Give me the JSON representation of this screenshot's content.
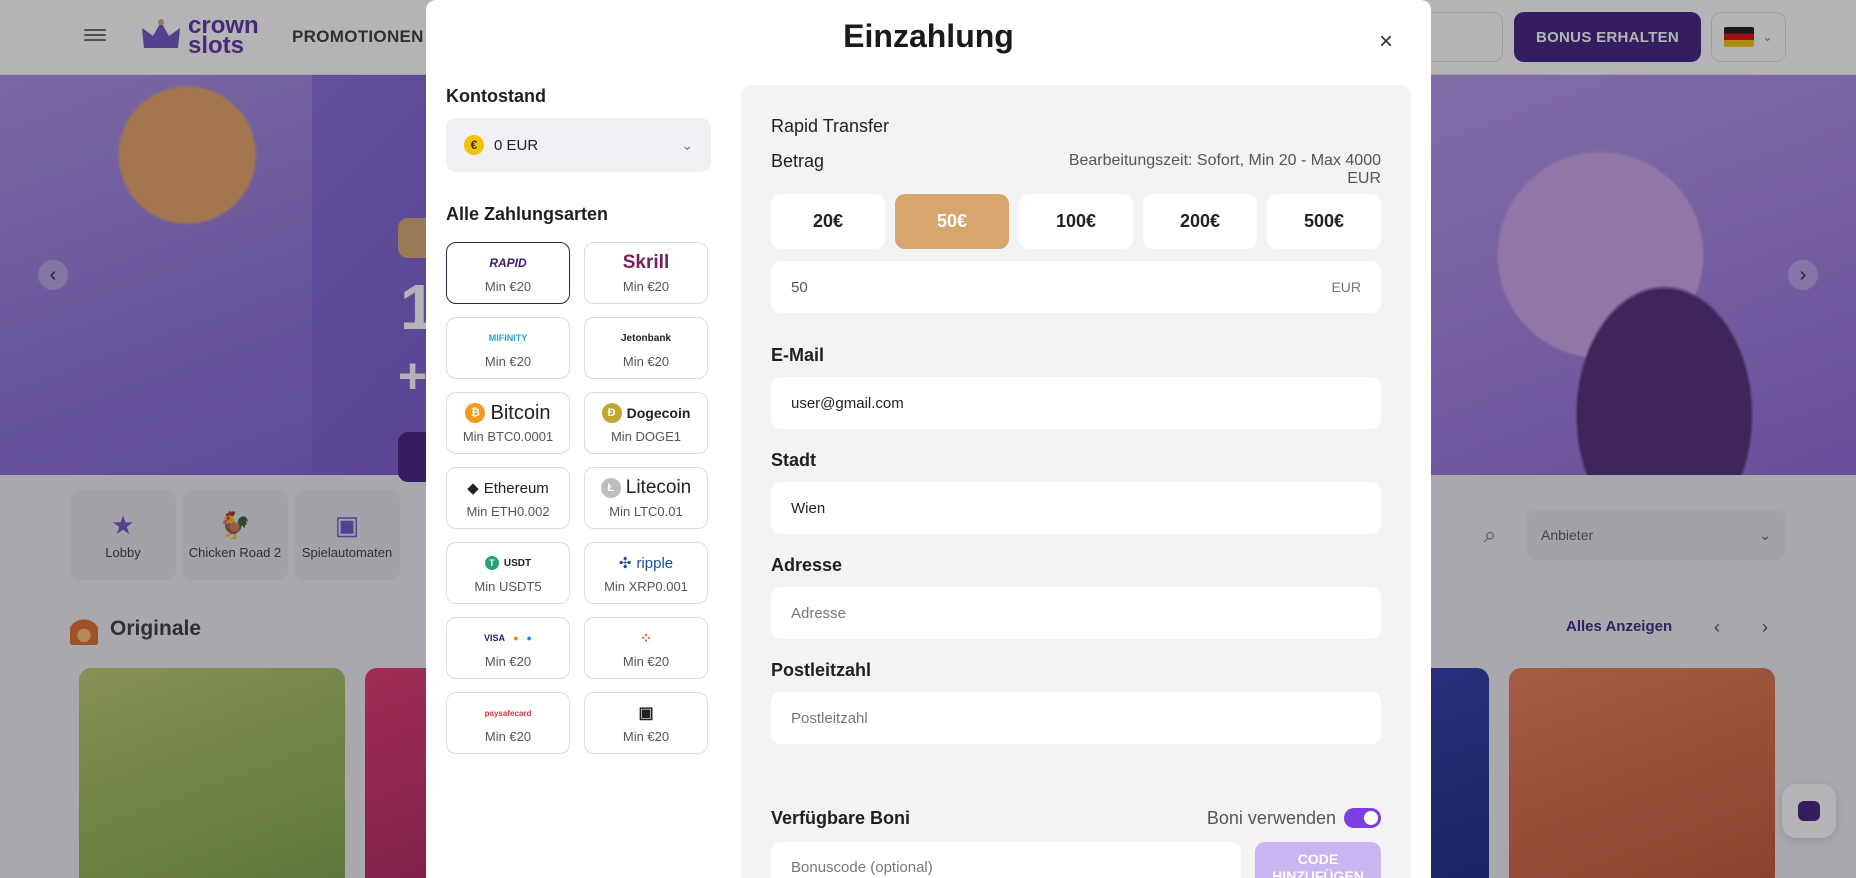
{
  "header": {
    "logo_line1": "crown",
    "logo_line2": "slots",
    "promotions": "PROMOTIONEN",
    "bonus_button": "BONUS ERHALTEN"
  },
  "banner": {
    "headline_1": "1",
    "headline_2": "+"
  },
  "categories": [
    {
      "label": "Lobby",
      "icon": "star-icon"
    },
    {
      "label": "Chicken Road 2",
      "icon": "chicken-icon"
    },
    {
      "label": "Spielautomaten",
      "icon": "slot-icon"
    }
  ],
  "filters": {
    "provider_placeholder": "Anbieter"
  },
  "originals": {
    "title": "Originale",
    "show_all": "Alles Anzeigen"
  },
  "modal": {
    "title": "Einzahlung",
    "balance_label": "Kontostand",
    "balance_value": "0 EUR",
    "currency_symbol": "€",
    "payment_methods_label": "Alle Zahlungsarten",
    "payment_methods": [
      {
        "name": "Rapid Transfer",
        "logo": "RAPID",
        "min": "Min €20",
        "selected": true
      },
      {
        "name": "Skrill",
        "logo": "Skrill",
        "min": "Min €20",
        "selected": false
      },
      {
        "name": "MiFinity",
        "logo": "MIFINITY",
        "min": "Min €20",
        "selected": false
      },
      {
        "name": "Jetonbank",
        "logo": "Jetonbank",
        "min": "Min €20",
        "selected": false
      },
      {
        "name": "Bitcoin",
        "logo": "Bitcoin",
        "min": "Min BTC0.0001",
        "selected": false
      },
      {
        "name": "Dogecoin",
        "logo": "Dogecoin",
        "min": "Min DOGE1",
        "selected": false
      },
      {
        "name": "Ethereum",
        "logo": "Ethereum",
        "min": "Min ETH0.002",
        "selected": false
      },
      {
        "name": "Litecoin",
        "logo": "Litecoin",
        "min": "Min LTC0.01",
        "selected": false
      },
      {
        "name": "USDT",
        "logo": "USDT",
        "min": "Min USDT5",
        "selected": false
      },
      {
        "name": "Ripple",
        "logo": "ripple",
        "min": "Min XRP0.001",
        "selected": false
      },
      {
        "name": "Cards",
        "logo": "VISA",
        "min": "Min €20",
        "selected": false
      },
      {
        "name": "Apps",
        "logo": "",
        "min": "Min €20",
        "selected": false
      },
      {
        "name": "Paysafecard",
        "logo": "paysafecard",
        "min": "Min €20",
        "selected": false
      },
      {
        "name": "Other",
        "logo": "",
        "min": "Min €20",
        "selected": false
      }
    ],
    "method_title": "Rapid Transfer",
    "amount_label": "Betrag",
    "processing_info": "Bearbeitungszeit: Sofort, Min 20 - Max 4000 EUR",
    "amounts": [
      "20€",
      "50€",
      "100€",
      "200€",
      "500€"
    ],
    "active_amount": "50€",
    "amount_value": "50",
    "amount_currency": "EUR",
    "email_label": "E-Mail",
    "email_value": "user@gmail.com",
    "city_label": "Stadt",
    "city_value": "Wien",
    "address_label": "Adresse",
    "address_placeholder": "Adresse",
    "postal_label": "Postleitzahl",
    "postal_placeholder": "Postleitzahl",
    "bonuses_label": "Verfügbare Boni",
    "use_bonuses_label": "Boni verwenden",
    "use_bonuses_on": true,
    "bonus_code_placeholder": "Bonuscode (optional)",
    "add_code_button": "CODE HINZUFÜGEN"
  },
  "colors": {
    "brand": "#3b1a78",
    "accent": "#d8a56c",
    "toggle": "#7b3fe4"
  }
}
